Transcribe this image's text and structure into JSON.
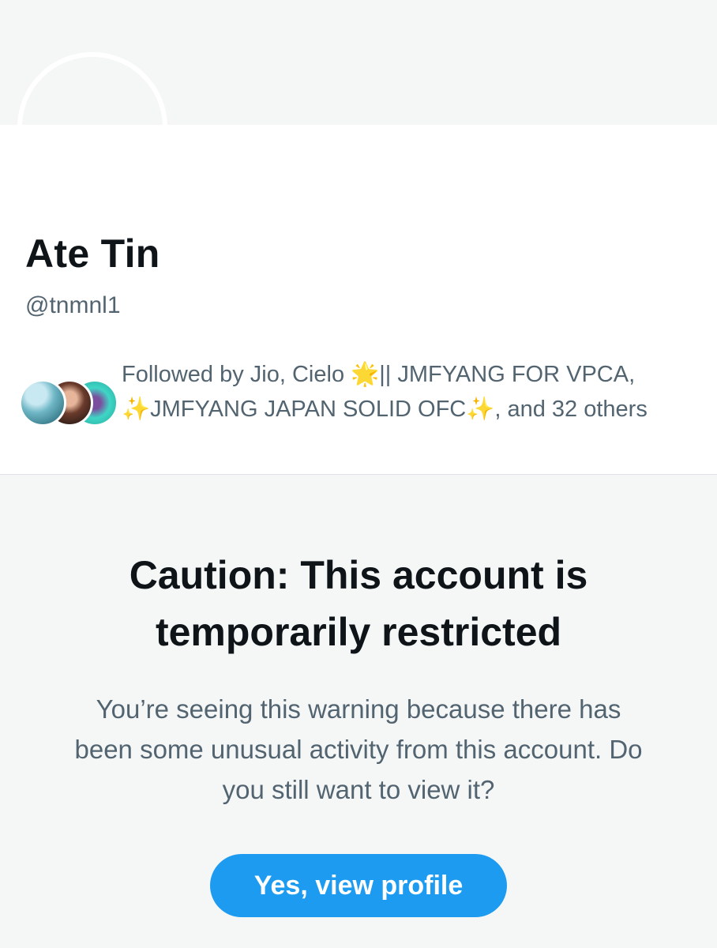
{
  "profile": {
    "display_name": "Ate Tin",
    "handle": "@tnmnl1"
  },
  "followed_by": {
    "prefix": "Followed by Jio, Cielo ",
    "star_emoji": "🌟",
    "middle": "|| JMFYANG FOR VPCA, ",
    "sparkle_open": "✨",
    "name2": "JMFYANG JAPAN SOLID OFC",
    "sparkle_close": "✨",
    "suffix": ", and 32 others"
  },
  "warning": {
    "title": "Caution: This account is temporarily restricted",
    "body": "You’re seeing this warning because there has been some unusual activity from this account. Do you still want to view it?",
    "button_label": "Yes, view profile"
  },
  "colors": {
    "accent": "#1d9bf0",
    "primary_text": "#0f1419",
    "secondary_text": "#536471",
    "background": "#f5f7f7"
  }
}
